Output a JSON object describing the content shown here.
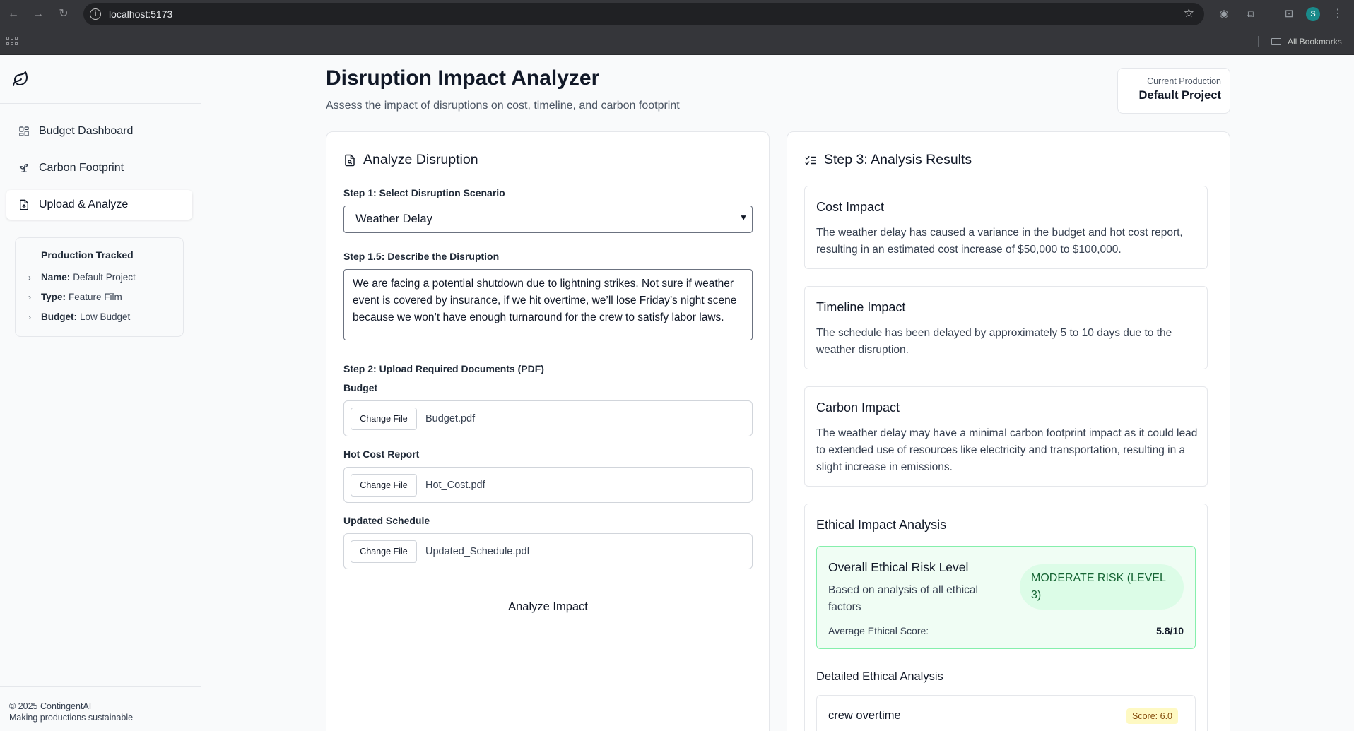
{
  "browser": {
    "url": "localhost:5173",
    "profile_initial": "S",
    "bookmarks_label": "All Bookmarks"
  },
  "sidebar": {
    "logo_icon": "leaf-icon",
    "nav": [
      {
        "label": "Budget Dashboard",
        "icon": "dashboard-grid-icon",
        "active": false
      },
      {
        "label": "Carbon Footprint",
        "icon": "sprout-icon",
        "active": false
      },
      {
        "label": "Upload & Analyze",
        "icon": "file-upload-icon",
        "active": true
      }
    ],
    "tracked": {
      "title": "Production Tracked",
      "rows": [
        {
          "key": "Name:",
          "value": "Default Project"
        },
        {
          "key": "Type:",
          "value": "Feature Film"
        },
        {
          "key": "Budget:",
          "value": "Low Budget"
        }
      ]
    },
    "footer": {
      "copyright": "© 2025 ContingentAI",
      "tagline": "Making productions sustainable"
    }
  },
  "header": {
    "title": "Disruption Impact Analyzer",
    "subtitle": "Assess the impact of disruptions on cost, timeline, and carbon footprint",
    "current_production_label": "Current Production",
    "current_production_value": "Default Project"
  },
  "analyze": {
    "title": "Analyze Disruption",
    "step1_label": "Step 1: Select Disruption Scenario",
    "scenario_value": "Weather Delay",
    "step15_label": "Step 1.5: Describe the Disruption",
    "description": "We are facing a potential shutdown due to lightning strikes. Not sure if weather event is covered by insurance, if we hit overtime, we’ll lose Friday’s night scene because we won’t have enough turnaround for the crew to satisfy labor laws.",
    "step2_label": "Step 2: Upload Required Documents (PDF)",
    "files": [
      {
        "label": "Budget",
        "button": "Change File",
        "filename": "Budget.pdf"
      },
      {
        "label": "Hot Cost Report",
        "button": "Change File",
        "filename": "Hot_Cost.pdf"
      },
      {
        "label": "Updated Schedule",
        "button": "Change File",
        "filename": "Updated_Schedule.pdf"
      }
    ],
    "analyze_button": "Analyze Impact"
  },
  "results": {
    "title": "Step 3: Analysis Results",
    "cost": {
      "title": "Cost Impact",
      "text": "The weather delay has caused a variance in the budget and hot cost report, resulting in an estimated cost increase of $50,000 to $100,000."
    },
    "timeline": {
      "title": "Timeline Impact",
      "text": "The schedule has been delayed by approximately 5 to 10 days due to the weather disruption."
    },
    "carbon": {
      "title": "Carbon Impact",
      "text": "The weather delay may have a minimal carbon footprint impact as it could lead to extended use of resources like electricity and transportation, resulting in a slight increase in emissions."
    },
    "ethics": {
      "title": "Ethical Impact Analysis",
      "overall_title": "Overall Ethical Risk Level",
      "overall_desc": "Based on analysis of all ethical factors",
      "risk_badge": "MODERATE RISK (LEVEL 3)",
      "avg_label": "Average Ethical Score:",
      "avg_value": "5.8/10",
      "detailed_title": "Detailed Ethical Analysis",
      "items": [
        {
          "name": "crew overtime",
          "score": "Score: 6.0"
        }
      ]
    }
  }
}
